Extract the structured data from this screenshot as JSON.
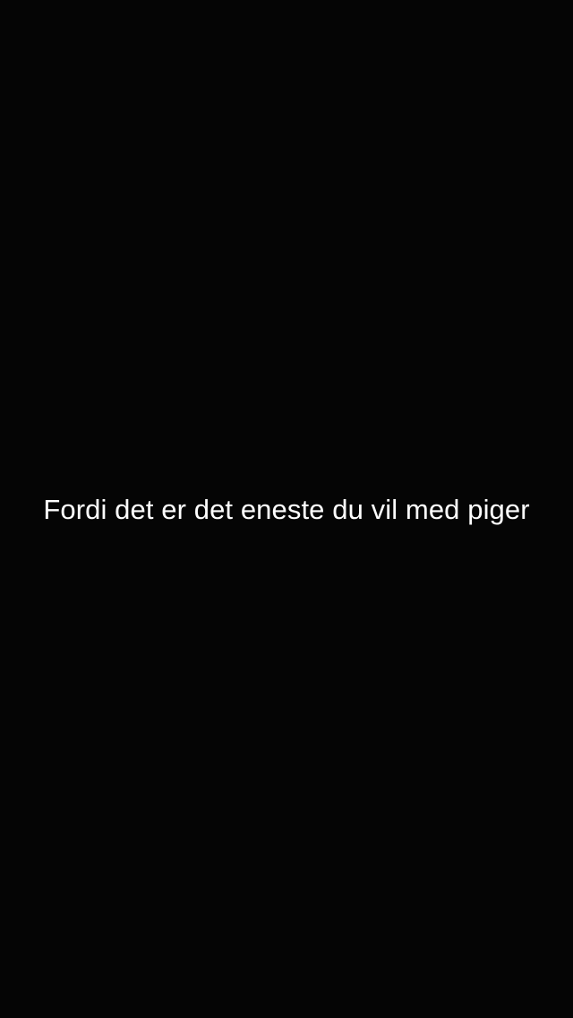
{
  "snap": {
    "caption": "Fordi det er det eneste du vil med piger"
  },
  "colors": {
    "background": "#050505",
    "caption_text": "#ffffff"
  }
}
